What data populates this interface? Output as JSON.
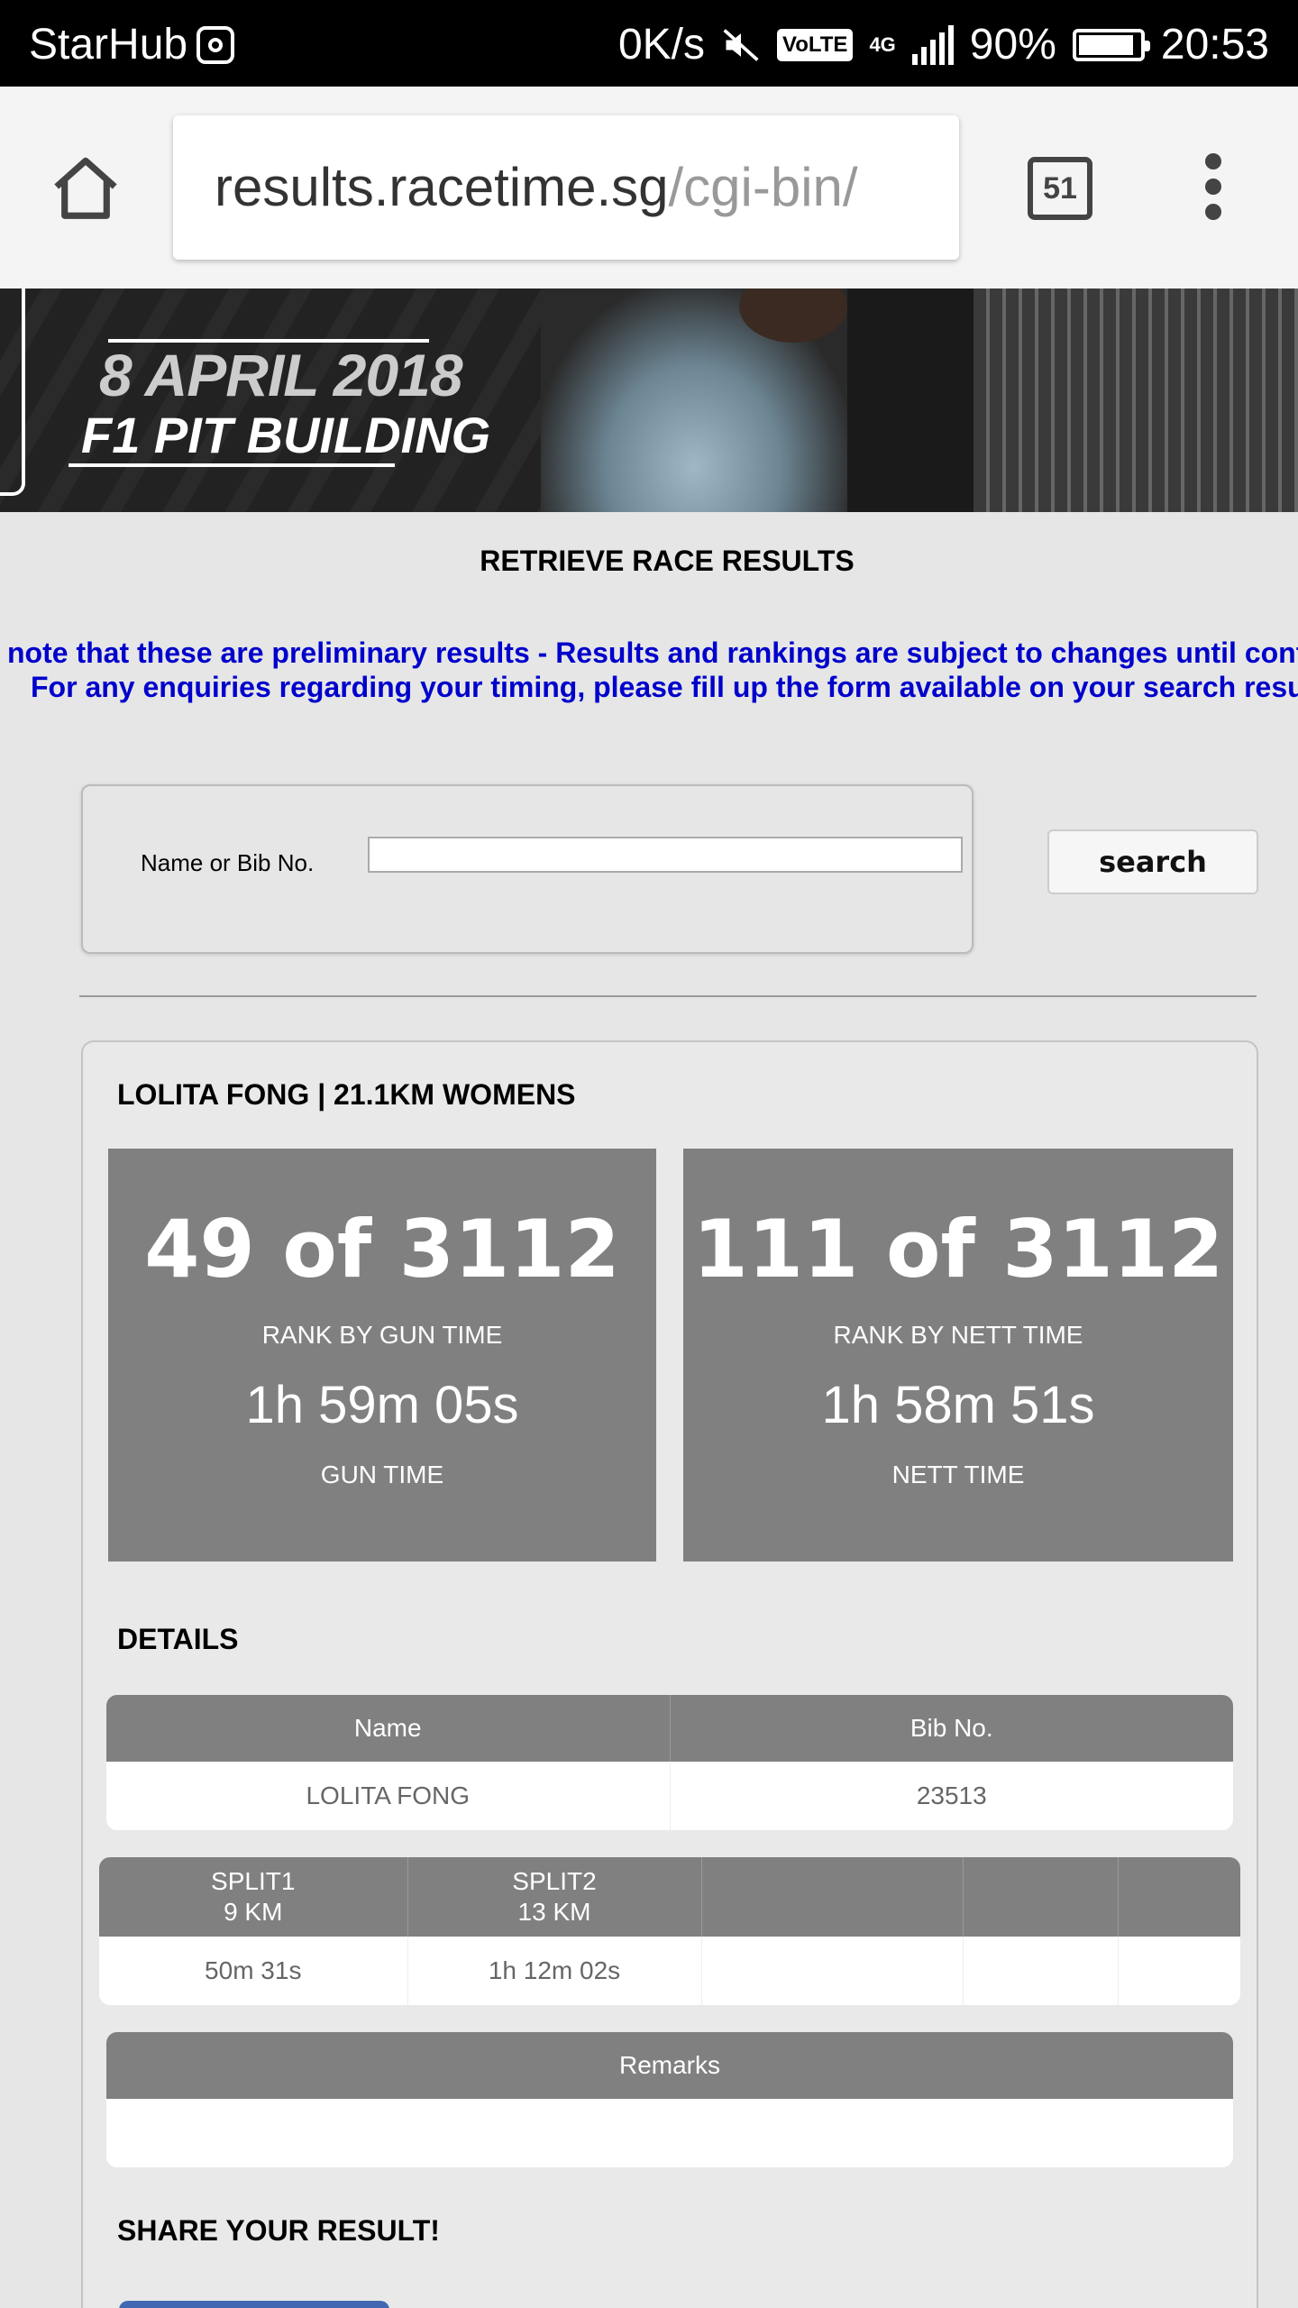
{
  "status_bar": {
    "carrier": "StarHub",
    "speed": "0K/s",
    "volte": "VoLTE",
    "network": "4G",
    "battery": "90%",
    "time": "20:53"
  },
  "browser": {
    "url_host": "results.racetime.sg",
    "url_path": "/cgi-bin/",
    "tab_count": "51"
  },
  "banner": {
    "date": "8 APRIL 2018",
    "venue": "F1 PIT BUILDING"
  },
  "page": {
    "title": "RETRIEVE RACE RESULTS",
    "notice_line1": "note that these are preliminary results - Results and rankings are subject to changes until confi",
    "notice_line2": "For any enquiries regarding your timing, please fill up the form available on your search result"
  },
  "search": {
    "label": "Name or Bib No.",
    "value": "",
    "button_label": "search"
  },
  "result": {
    "heading": "LOLITA FONG | 21.1KM WOMENS",
    "gun": {
      "rank": "49 of 3112",
      "rank_label": "RANK BY GUN TIME",
      "time": "1h 59m 05s",
      "time_label": "GUN TIME"
    },
    "nett": {
      "rank": "111 of 3112",
      "rank_label": "RANK BY NETT TIME",
      "time": "1h 58m 51s",
      "time_label": "NETT TIME"
    },
    "details_heading": "DETAILS",
    "details": {
      "headers": [
        "Name",
        "Bib No."
      ],
      "values": [
        "LOLITA FONG",
        "23513"
      ]
    },
    "splits": {
      "headers": [
        {
          "name": "SPLIT1",
          "distance": "9 KM"
        },
        {
          "name": "SPLIT2",
          "distance": "13 KM"
        }
      ],
      "values": [
        "50m 31s",
        "1h 12m 02s"
      ]
    },
    "remarks": {
      "header": "Remarks",
      "value": ""
    },
    "share_heading": "SHARE YOUR RESULT!"
  },
  "colors": {
    "stat_box": "#808080",
    "notice_text": "#0000cc",
    "page_bg": "#e6e6e6"
  }
}
